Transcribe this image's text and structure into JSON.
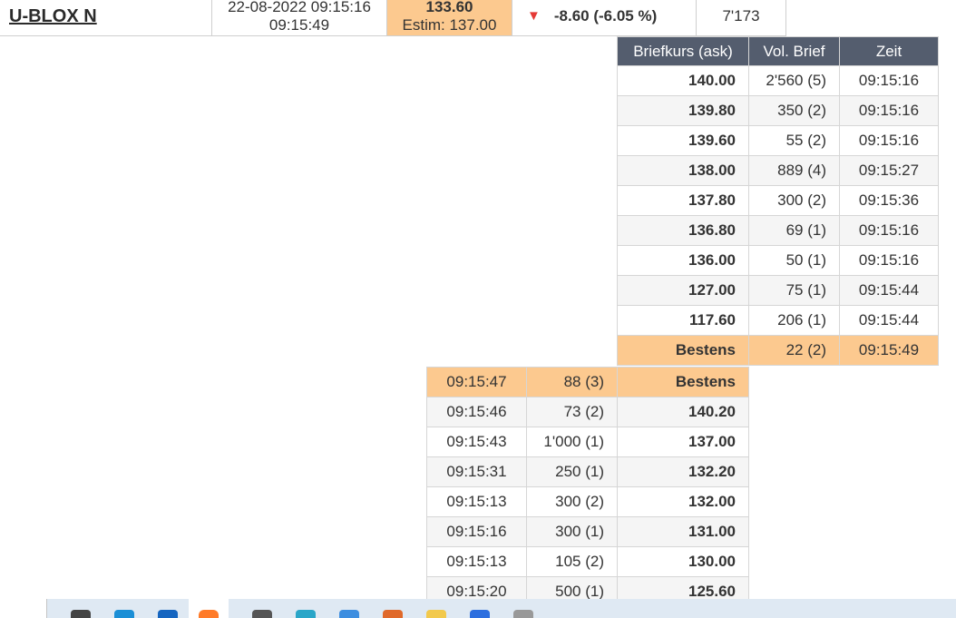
{
  "header": {
    "name": "U-BLOX N",
    "datetime": "22-08-2022 09:15:16",
    "time": "09:15:49",
    "last_price": "133.60",
    "estim": "Estim: 137.00",
    "change": "-8.60 (-6.05 %)",
    "volume": "7'173"
  },
  "ask": {
    "headers": [
      "Briefkurs (ask)",
      "Vol. Brief",
      "Zeit"
    ],
    "rows": [
      {
        "price": "140.00",
        "vol": "2'560 (5)",
        "time": "09:15:16"
      },
      {
        "price": "139.80",
        "vol": "350 (2)",
        "time": "09:15:16"
      },
      {
        "price": "139.60",
        "vol": "55 (2)",
        "time": "09:15:16"
      },
      {
        "price": "138.00",
        "vol": "889 (4)",
        "time": "09:15:27"
      },
      {
        "price": "137.80",
        "vol": "300 (2)",
        "time": "09:15:36"
      },
      {
        "price": "136.80",
        "vol": "69 (1)",
        "time": "09:15:16"
      },
      {
        "price": "136.00",
        "vol": "50 (1)",
        "time": "09:15:16"
      },
      {
        "price": "127.00",
        "vol": "75 (1)",
        "time": "09:15:44"
      },
      {
        "price": "117.60",
        "vol": "206 (1)",
        "time": "09:15:44"
      },
      {
        "price": "Bestens",
        "vol": "22 (2)",
        "time": "09:15:49"
      }
    ]
  },
  "bid": {
    "rows": [
      {
        "time": "09:15:47",
        "vol": "88 (3)",
        "price": "Bestens"
      },
      {
        "time": "09:15:46",
        "vol": "73 (2)",
        "price": "140.20"
      },
      {
        "time": "09:15:43",
        "vol": "1'000 (1)",
        "price": "137.00"
      },
      {
        "time": "09:15:31",
        "vol": "250 (1)",
        "price": "132.20"
      },
      {
        "time": "09:15:13",
        "vol": "300 (2)",
        "price": "132.00"
      },
      {
        "time": "09:15:16",
        "vol": "300 (1)",
        "price": "131.00"
      },
      {
        "time": "09:15:13",
        "vol": "105 (2)",
        "price": "130.00"
      },
      {
        "time": "09:15:20",
        "vol": "500 (1)",
        "price": "125.60"
      }
    ]
  },
  "taskbar": {
    "icons": [
      {
        "name": "task-view-icon",
        "color": "#444444"
      },
      {
        "name": "edge-icon",
        "color": "#1b8fd6"
      },
      {
        "name": "store-icon",
        "color": "#1565c0"
      },
      {
        "name": "firefox-icon",
        "color": "#ff7b29"
      },
      {
        "name": "app-icon",
        "color": "#555555"
      },
      {
        "name": "cloud-app-icon",
        "color": "#2aa6c8"
      },
      {
        "name": "dropbox-icon",
        "color": "#3d8ee0"
      },
      {
        "name": "media-icon",
        "color": "#e0692a"
      },
      {
        "name": "folder-icon",
        "color": "#f2c94c"
      },
      {
        "name": "maps-icon",
        "color": "#2d6fdf"
      },
      {
        "name": "tool-icon",
        "color": "#999999"
      }
    ]
  },
  "colors": {
    "highlight": "#fcc98f",
    "header_bg": "#545d6e",
    "down_arrow": "#e53935"
  }
}
